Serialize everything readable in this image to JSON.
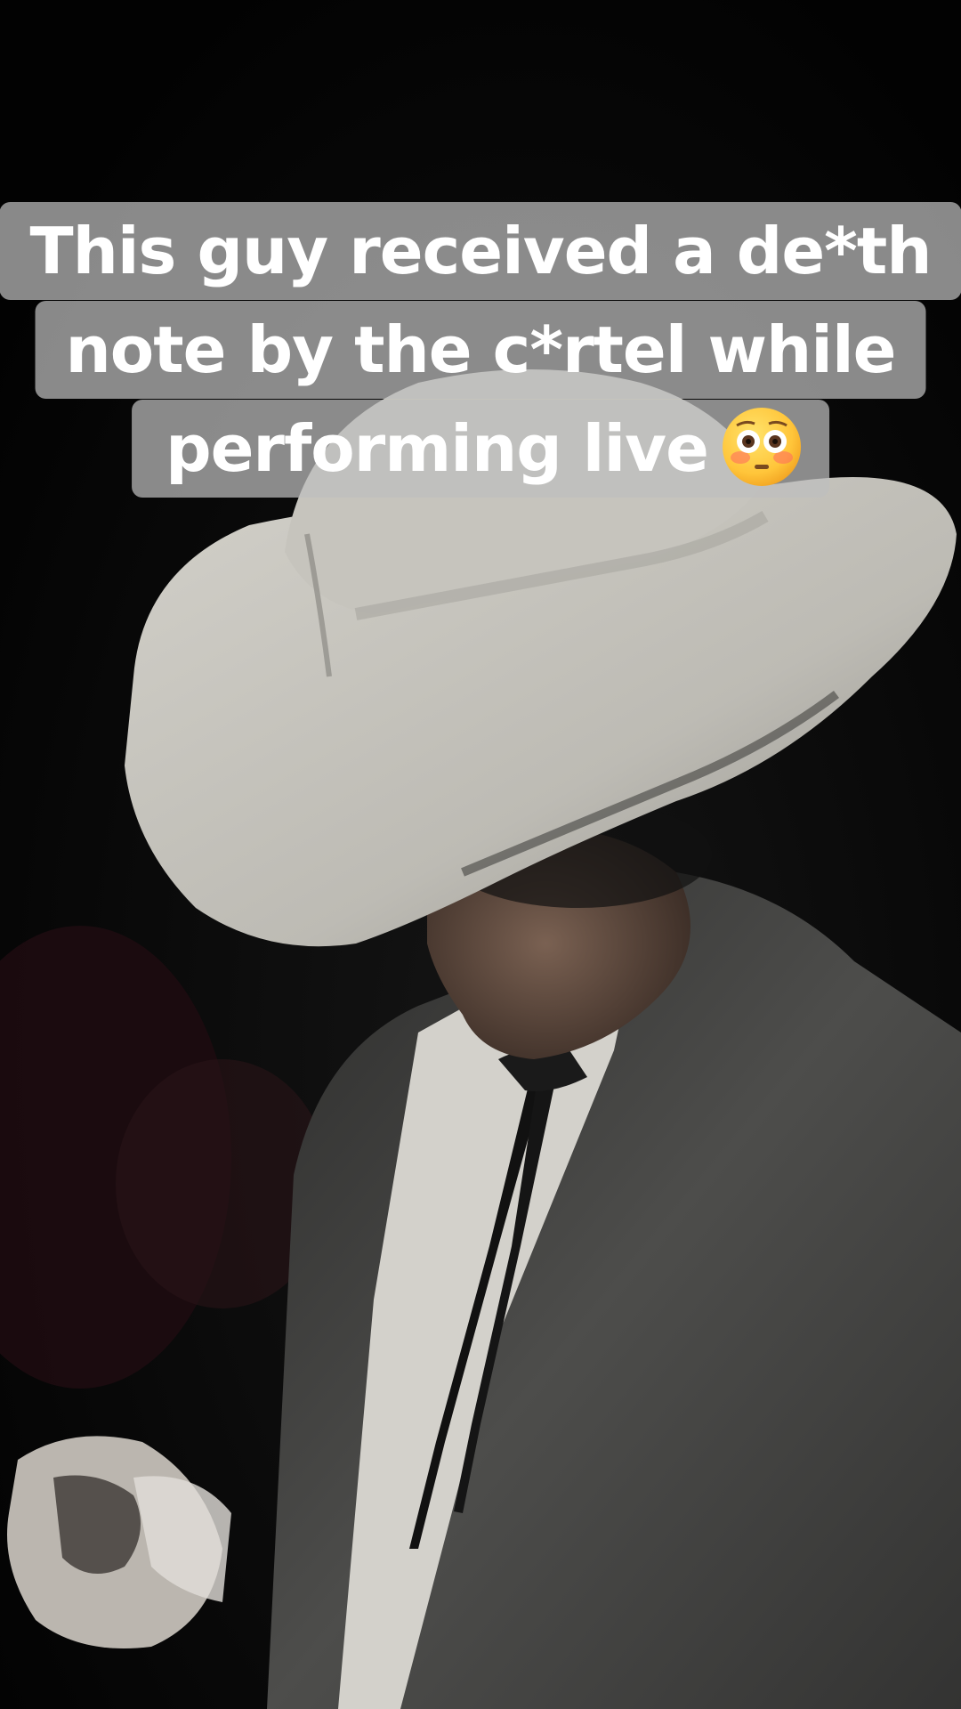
{
  "caption": {
    "lines": [
      "This guy received a de*th",
      "note by the c*rtel while",
      "performing live"
    ],
    "emoji": "flushed-face"
  },
  "scene": {
    "subject": "performer-in-white-cowboy-hat",
    "colors": {
      "background": "#030303",
      "hat": "#c9c7c0",
      "suit": "#4a4a48",
      "shirt": "#d8d6d0",
      "skin": "#6b5446"
    }
  }
}
